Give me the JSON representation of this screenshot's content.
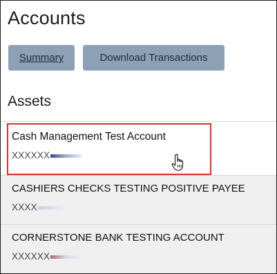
{
  "page": {
    "title": "Accounts"
  },
  "toolbar": {
    "summary_label": "Summary",
    "download_label": "Download Transactions"
  },
  "assets": {
    "section_title": "Assets",
    "accounts": [
      {
        "name": "Cash Management Test Account",
        "number_masked": "XXXXXX"
      },
      {
        "name": "CASHIERS CHECKS TESTING POSITIVE PAYEE",
        "number_masked": "XXXX"
      },
      {
        "name": "CORNERSTONE BANK TESTING ACCOUNT",
        "number_masked": "XXXXXX"
      }
    ]
  },
  "colors": {
    "button_bg": "#8da1b6",
    "highlight_border": "#e02a2a",
    "row_alt_bg": "#efefef"
  },
  "icons": {
    "cursor": "hand-pointer-icon"
  }
}
